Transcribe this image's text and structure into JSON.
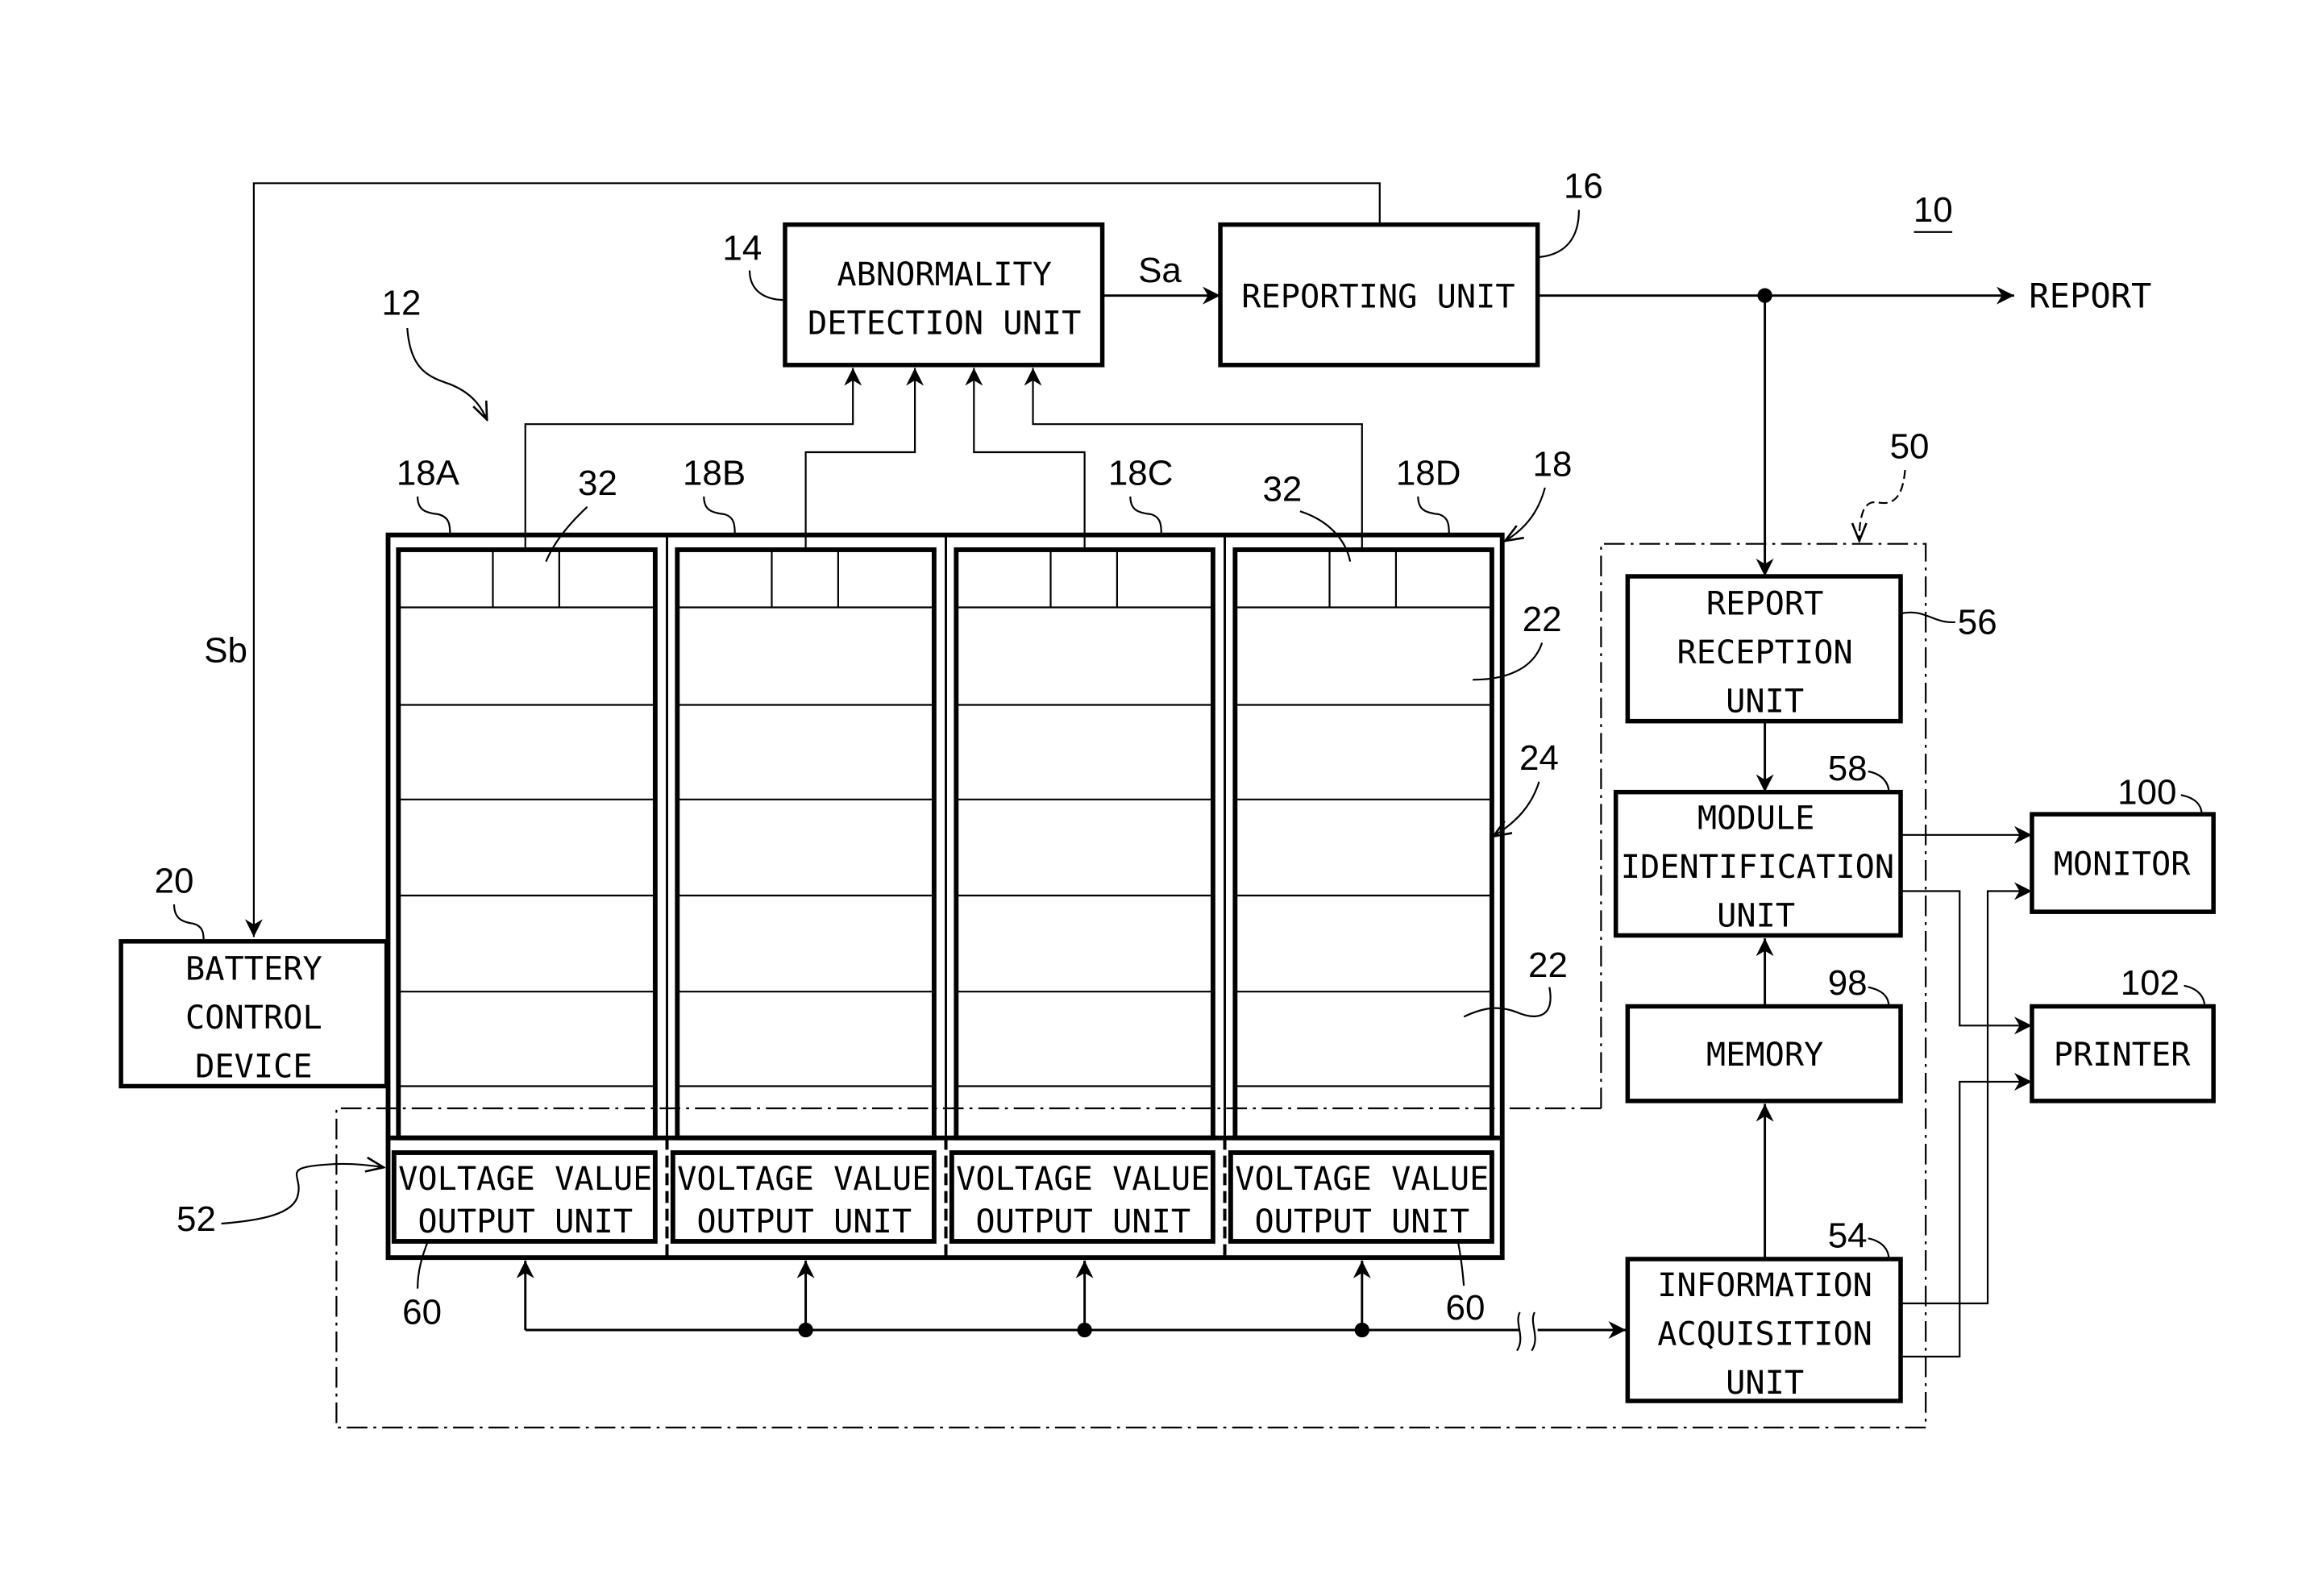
{
  "figure": {
    "system_ref": "10",
    "blocks": {
      "abnormality_detection": {
        "ref": "14",
        "lines": [
          "ABNORMALITY",
          "DETECTION UNIT"
        ]
      },
      "reporting_unit": {
        "ref": "16",
        "lines": [
          "REPORTING UNIT"
        ]
      },
      "battery_control": {
        "ref": "20",
        "lines": [
          "BATTERY",
          "CONTROL",
          "DEVICE"
        ]
      },
      "report_reception": {
        "ref": "56",
        "lines": [
          "REPORT",
          "RECEPTION",
          "UNIT"
        ]
      },
      "module_identification": {
        "ref": "58",
        "lines": [
          "MODULE",
          "IDENTIFICATION",
          "UNIT"
        ]
      },
      "memory": {
        "ref": "98",
        "lines": [
          "MEMORY"
        ]
      },
      "information_acquisition": {
        "ref": "54",
        "lines": [
          "INFORMATION",
          "ACQUISITION",
          "UNIT"
        ]
      },
      "monitor": {
        "ref": "100",
        "lines": [
          "MONITOR"
        ]
      },
      "printer": {
        "ref": "102",
        "lines": [
          "PRINTER"
        ]
      }
    },
    "signals": {
      "sa": "Sa",
      "sb": "Sb",
      "report_output": "REPORT"
    },
    "battery": {
      "system_ref": "12",
      "rack_ref": "18",
      "module_ref": "22",
      "frame_ref": "24",
      "cell_ref": "32",
      "voltage_group_ref": "52",
      "voltage_unit_ref": "60",
      "monitoring_ref": "50",
      "columns": [
        {
          "ref": "18A",
          "voltage_unit": [
            "VOLTAGE VALUE",
            "OUTPUT UNIT"
          ]
        },
        {
          "ref": "18B",
          "voltage_unit": [
            "VOLTAGE VALUE",
            "OUTPUT UNIT"
          ]
        },
        {
          "ref": "18C",
          "voltage_unit": [
            "VOLTAGE VALUE",
            "OUTPUT UNIT"
          ]
        },
        {
          "ref": "18D",
          "voltage_unit": [
            "VOLTAGE VALUE",
            "OUTPUT UNIT"
          ]
        }
      ]
    }
  }
}
